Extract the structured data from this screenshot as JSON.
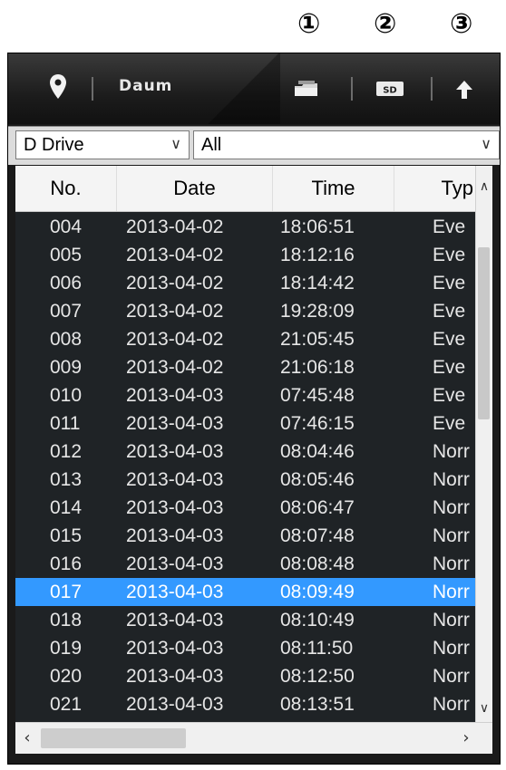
{
  "callouts": [
    "①",
    "②",
    "③"
  ],
  "toolbar": {
    "title": "Daum",
    "icons": [
      "location-pin-icon",
      "folder-icon",
      "sd-card-icon",
      "upload-arrow-icon"
    ],
    "sd_label": "SD"
  },
  "filters": {
    "drive": "D Drive",
    "type": "All"
  },
  "table": {
    "headers": [
      "No.",
      "Date",
      "Time",
      "Typ"
    ],
    "selected_row": "017",
    "rows": [
      {
        "no": "004",
        "date": "2013-04-02",
        "time": "18:06:51",
        "type": "Eve"
      },
      {
        "no": "005",
        "date": "2013-04-02",
        "time": "18:12:16",
        "type": "Eve"
      },
      {
        "no": "006",
        "date": "2013-04-02",
        "time": "18:14:42",
        "type": "Eve"
      },
      {
        "no": "007",
        "date": "2013-04-02",
        "time": "19:28:09",
        "type": "Eve"
      },
      {
        "no": "008",
        "date": "2013-04-02",
        "time": "21:05:45",
        "type": "Eve"
      },
      {
        "no": "009",
        "date": "2013-04-02",
        "time": "21:06:18",
        "type": "Eve"
      },
      {
        "no": "010",
        "date": "2013-04-03",
        "time": "07:45:48",
        "type": "Eve"
      },
      {
        "no": "011",
        "date": "2013-04-03",
        "time": "07:46:15",
        "type": "Eve"
      },
      {
        "no": "012",
        "date": "2013-04-03",
        "time": "08:04:46",
        "type": "Norr"
      },
      {
        "no": "013",
        "date": "2013-04-03",
        "time": "08:05:46",
        "type": "Norr"
      },
      {
        "no": "014",
        "date": "2013-04-03",
        "time": "08:06:47",
        "type": "Norr"
      },
      {
        "no": "015",
        "date": "2013-04-03",
        "time": "08:07:48",
        "type": "Norr"
      },
      {
        "no": "016",
        "date": "2013-04-03",
        "time": "08:08:48",
        "type": "Norr"
      },
      {
        "no": "017",
        "date": "2013-04-03",
        "time": "08:09:49",
        "type": "Norr"
      },
      {
        "no": "018",
        "date": "2013-04-03",
        "time": "08:10:49",
        "type": "Norr"
      },
      {
        "no": "019",
        "date": "2013-04-03",
        "time": "08:11:50",
        "type": "Norr"
      },
      {
        "no": "020",
        "date": "2013-04-03",
        "time": "08:12:50",
        "type": "Norr"
      },
      {
        "no": "021",
        "date": "2013-04-03",
        "time": "08:13:51",
        "type": "Norr"
      }
    ]
  },
  "colors": {
    "selection": "#3399ff",
    "list_background": "#1f2326",
    "toolbar_background": "#1c1c1c"
  }
}
